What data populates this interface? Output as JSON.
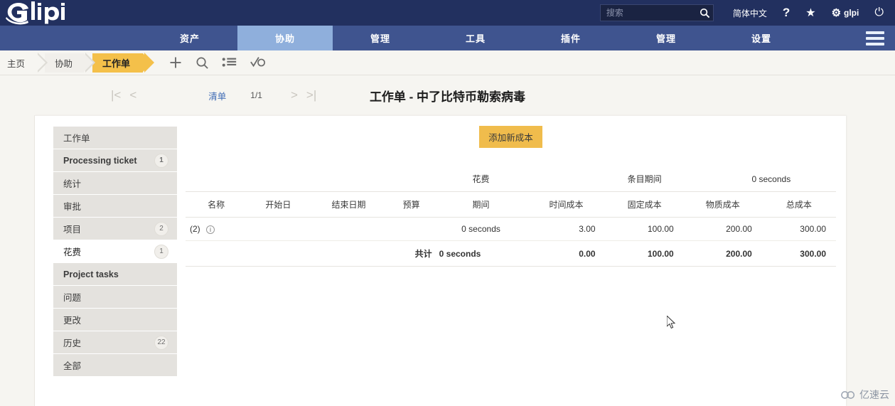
{
  "header": {
    "logo_text": "Glpi",
    "search": {
      "placeholder": "搜索",
      "value": "",
      "icon": "search-icon"
    },
    "language": "简体中文",
    "help_icon": "?",
    "star_icon": "★",
    "gear_icon": "⚙",
    "user": "glpi",
    "power_icon": "⏻"
  },
  "nav": {
    "items": [
      {
        "label": "资产",
        "active": false
      },
      {
        "label": "协助",
        "active": true
      },
      {
        "label": "管理",
        "active": false
      },
      {
        "label": "工具",
        "active": false
      },
      {
        "label": "插件",
        "active": false
      },
      {
        "label": "管理",
        "active": false
      },
      {
        "label": "设置",
        "active": false
      }
    ],
    "menu_icon": "hamburger-icon"
  },
  "breadcrumb": {
    "items": [
      "主页",
      "协助",
      "工作单"
    ],
    "tools": [
      "add-icon",
      "search-icon",
      "list-icon",
      "checklist-icon"
    ]
  },
  "pager": {
    "first_icon": "|<",
    "prev_icon": "<",
    "list_label": "清单",
    "title": "工作单 - 中了比特币勒索病毒",
    "count": "1/1",
    "next_icon": ">",
    "last_icon": ">|"
  },
  "sidebar": {
    "items": [
      {
        "label": "工作单",
        "badge": "",
        "english": false,
        "selected": false
      },
      {
        "label": "Processing ticket",
        "badge": "1",
        "english": true,
        "selected": false
      },
      {
        "label": "统计",
        "badge": "",
        "english": false,
        "selected": false
      },
      {
        "label": "审批",
        "badge": "",
        "english": false,
        "selected": false
      },
      {
        "label": "项目",
        "badge": "2",
        "english": false,
        "selected": false
      },
      {
        "label": "花费",
        "badge": "1",
        "english": false,
        "selected": true
      },
      {
        "label": "Project tasks",
        "badge": "",
        "english": true,
        "selected": false
      },
      {
        "label": "问题",
        "badge": "",
        "english": false,
        "selected": false
      },
      {
        "label": "更改",
        "badge": "",
        "english": false,
        "selected": false
      },
      {
        "label": "历史",
        "badge": "22",
        "english": false,
        "selected": false
      },
      {
        "label": "全部",
        "badge": "",
        "english": false,
        "selected": false
      }
    ]
  },
  "main": {
    "add_button": "添加新成本",
    "table": {
      "section_title": "花费",
      "duration_label": "条目期间",
      "duration_value": "0 seconds",
      "columns": [
        "名称",
        "开始日",
        "结束日期",
        "预算",
        "期间",
        "时间成本",
        "固定成本",
        "物质成本",
        "总成本"
      ],
      "rows": [
        {
          "name": "(2)",
          "info_icon": "ⓘ",
          "begin": "",
          "end": "",
          "budget": "",
          "duration": "0 seconds",
          "time_cost": "3.00",
          "fixed_cost": "100.00",
          "material_cost": "200.00",
          "total_cost": "300.00"
        }
      ],
      "total_row": {
        "label": "共计",
        "duration": "0 seconds",
        "time_cost": "0.00",
        "fixed_cost": "100.00",
        "material_cost": "200.00",
        "total_cost": "300.00"
      }
    }
  },
  "watermark": {
    "text": "亿速云"
  },
  "colors": {
    "header_bg": "#22305f",
    "nav_bg": "#3f548f",
    "nav_active": "#8fafdc",
    "accent_yellow": "#f4c04a",
    "button_yellow": "#f0bc4c",
    "link_blue": "#3f6bb5",
    "page_bg": "#f6f5f1"
  }
}
